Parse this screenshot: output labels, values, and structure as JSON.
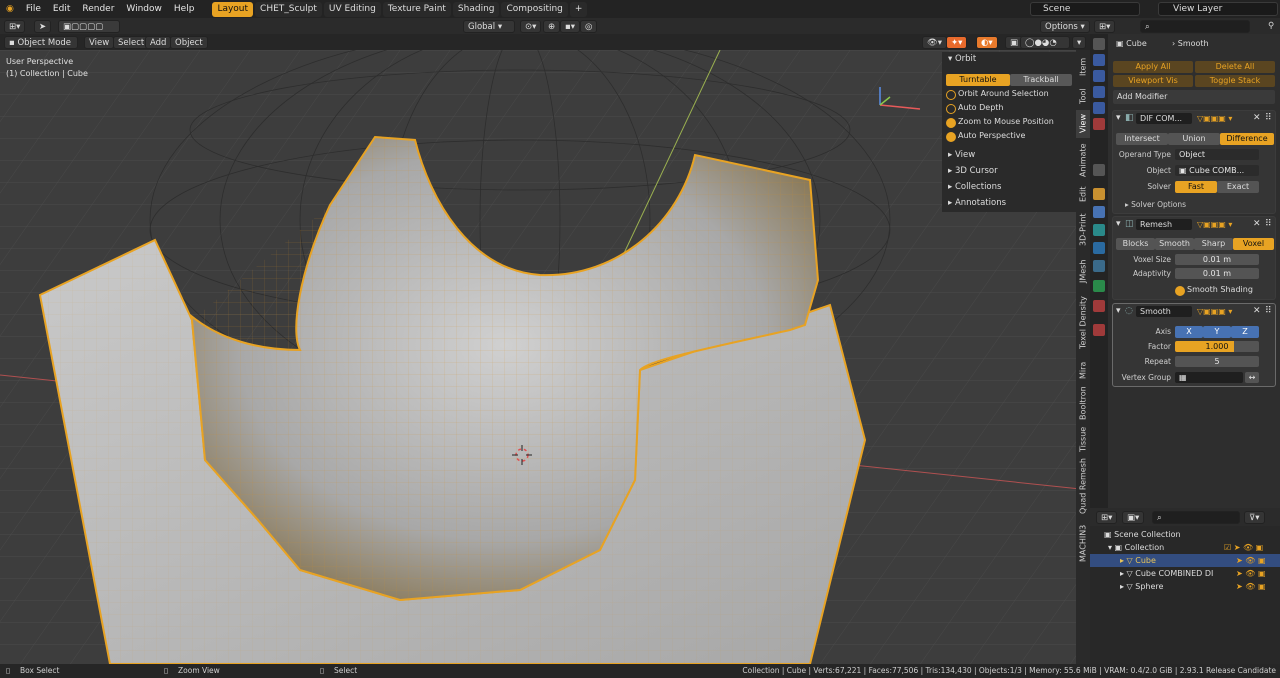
{
  "menu": [
    "File",
    "Edit",
    "Render",
    "Window",
    "Help"
  ],
  "workspaces": [
    {
      "label": "Layout",
      "active": true
    },
    {
      "label": "CHET_Sculpt",
      "active": false
    },
    {
      "label": "UV Editing",
      "active": false
    },
    {
      "label": "Texture Paint",
      "active": false
    },
    {
      "label": "Shading",
      "active": false
    },
    {
      "label": "Compositing",
      "active": false
    },
    {
      "label": "+",
      "active": false
    }
  ],
  "scene": "Scene",
  "view_layer": "View Layer",
  "viewport_header": {
    "mode": "Object Mode",
    "menus": [
      "View",
      "Select",
      "Add",
      "Object"
    ],
    "orientation": "Global",
    "options": "Options"
  },
  "viewport_overlay": {
    "perspective": "User Perspective",
    "collection": "(1) Collection | Cube"
  },
  "npanel": {
    "orbit_title": "Orbit",
    "turntable": "Turntable",
    "trackball": "Trackball",
    "checks": [
      {
        "label": "Orbit Around Selection",
        "on": false
      },
      {
        "label": "Auto Depth",
        "on": false
      },
      {
        "label": "Zoom to Mouse Position",
        "on": true
      },
      {
        "label": "Auto Perspective",
        "on": true
      }
    ],
    "sections": [
      "View",
      "3D Cursor",
      "Collections",
      "Annotations"
    ]
  },
  "side_tabs": [
    "Item",
    "Tool",
    "View",
    "Animate",
    "Edit",
    "3D-Print",
    "JMesh",
    "Texel Density",
    "Mira",
    "Booltron",
    "Tissue",
    "Quad Remesh",
    "MACHIN3"
  ],
  "props": {
    "object": "Cube",
    "modifier_name": "Smooth",
    "apply_all": "Apply All",
    "delete_all": "Delete All",
    "viewport_vis": "Viewport Vis",
    "toggle_stack": "Toggle Stack",
    "add_modifier": "Add Modifier",
    "boolean": {
      "name": "DIF COM...",
      "ops": [
        "Intersect",
        "Union",
        "Difference"
      ],
      "operand_label": "Operand Type",
      "operand_value": "Object",
      "object_label": "Object",
      "object_value": "Cube COMB...",
      "solver_label": "Solver",
      "solver_fast": "Fast",
      "solver_exact": "Exact",
      "solver_options": "Solver Options"
    },
    "remesh": {
      "name": "Remesh",
      "modes": [
        "Blocks",
        "Smooth",
        "Sharp",
        "Voxel"
      ],
      "voxel_size_label": "Voxel Size",
      "voxel_size": "0.01 m",
      "adaptivity_label": "Adaptivity",
      "adaptivity": "0.01 m",
      "smooth_shading": "Smooth Shading"
    },
    "smooth": {
      "name": "Smooth",
      "axis_label": "Axis",
      "axes": [
        "X",
        "Y",
        "Z"
      ],
      "factor_label": "Factor",
      "factor": "1.000",
      "repeat_label": "Repeat",
      "repeat": "5",
      "vgroup_label": "Vertex Group"
    }
  },
  "outliner": {
    "rows": [
      {
        "label": "Scene Collection",
        "indent": 0
      },
      {
        "label": "Collection",
        "indent": 1
      },
      {
        "label": "Cube",
        "indent": 2,
        "selected": true
      },
      {
        "label": "Cube COMBINED DI",
        "indent": 2
      },
      {
        "label": "Sphere",
        "indent": 2
      }
    ]
  },
  "status": {
    "left": "Box Select",
    "middle": "Zoom View",
    "right": "Select",
    "stats": "Collection | Cube | Verts:67,221 | Faces:77,506 | Tris:134,430 | Objects:1/3 | Memory: 55.6 MiB | VRAM: 0.4/2.0 GiB | 2.93.1 Release Candidate"
  },
  "colors": {
    "accent": "#e8a323",
    "blue": "#4772b3",
    "bg": "#3d3d3d"
  }
}
